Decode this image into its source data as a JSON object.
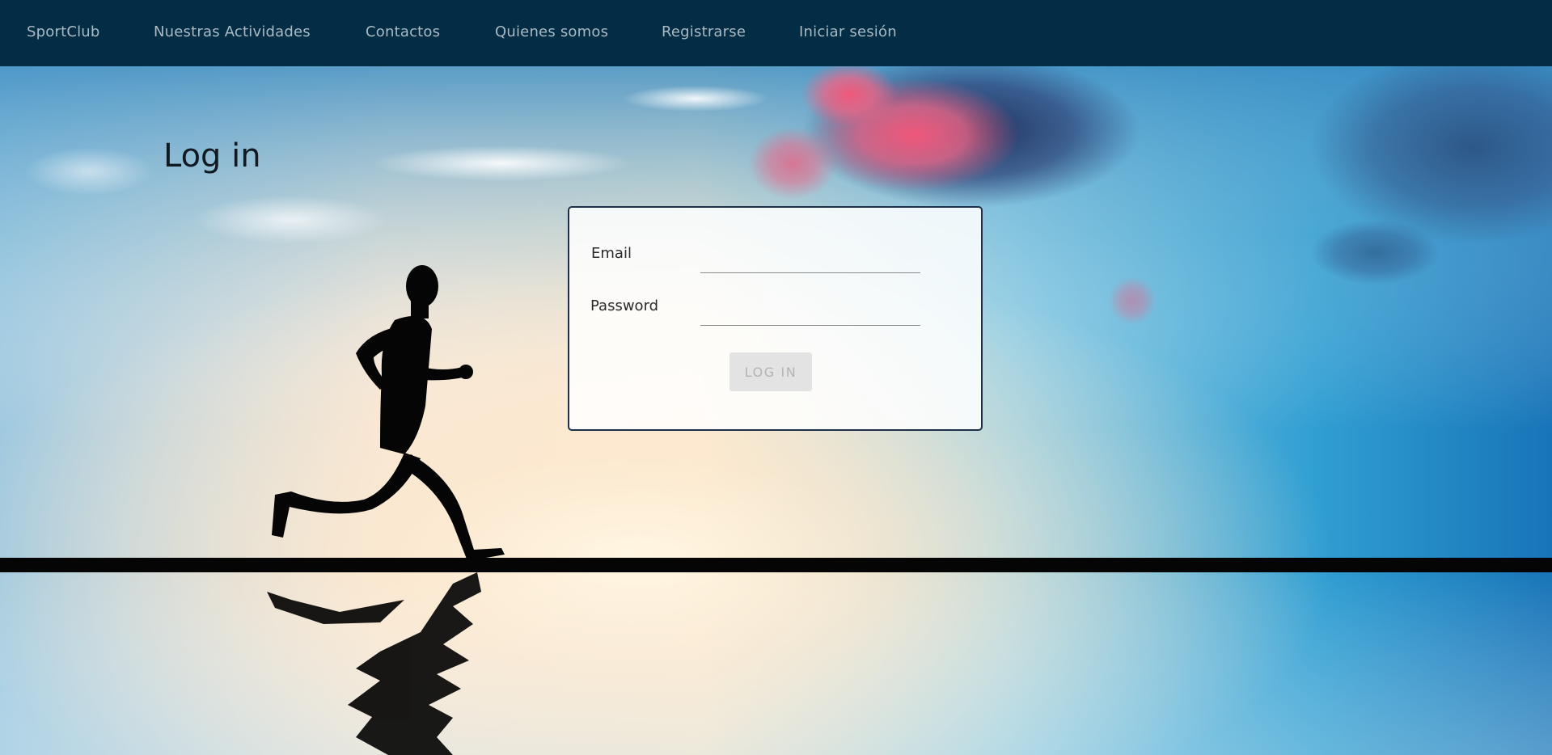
{
  "nav": {
    "brand": "SportClub",
    "items": [
      {
        "label": "Nuestras Actividades"
      },
      {
        "label": "Contactos"
      },
      {
        "label": "Quienes somos"
      },
      {
        "label": "Registrarse"
      },
      {
        "label": "Iniciar sesión"
      }
    ]
  },
  "page": {
    "title": "Log in"
  },
  "form": {
    "email_label": "Email",
    "email_value": "",
    "password_label": "Password",
    "password_value": "",
    "submit_label": "LOG IN"
  },
  "colors": {
    "navbar_bg": "#032d44",
    "nav_text": "#a9bac5",
    "card_border": "#1d2f49",
    "button_bg": "#e3e3e3",
    "button_text": "#b3b3b3"
  },
  "background": {
    "subject": "runner-silhouette-icon"
  }
}
